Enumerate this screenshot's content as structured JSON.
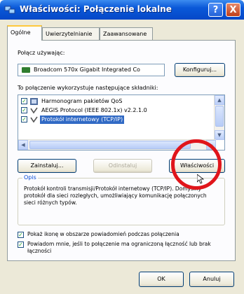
{
  "window": {
    "title": "Właściwości: Połączenie lokalne",
    "help": "?",
    "close": "X"
  },
  "tabs": [
    "Ogólne",
    "Uwierzytelnianie",
    "Zaawansowane"
  ],
  "general": {
    "connect_using_label": "Połącz używając:",
    "device": "Broadcom 570x Gigabit Integrated Co",
    "configure_button": "Konfiguruj...",
    "components_label": "To połączenie wykorzystuje następujące składniki:",
    "components": [
      {
        "label": "Harmonogram pakietów QoS",
        "checked": true,
        "selected": false
      },
      {
        "label": "AEGIS Protocol (IEEE 802.1x) v2.2.1.0",
        "checked": true,
        "selected": false
      },
      {
        "label": "Protokół internetowy (TCP/IP)",
        "checked": true,
        "selected": true
      }
    ],
    "install_button": "Zainstaluj...",
    "uninstall_button": "Odinstaluj",
    "properties_button": "Właściwości",
    "description_legend": "Opis",
    "description": "Protokół kontroli transmisji/Protokół internetowy (TCP/IP). Domyślny protokół dla sieci rozległych, umożliwiający komunikację połączonych sieci różnych typów.",
    "show_icon_checkbox": "Pokaż ikonę w obszarze powiadomień podczas połączenia",
    "notify_checkbox": "Powiadom mnie, jeśli to połączenie ma ograniczoną łączność lub brak łączności"
  },
  "footer": {
    "ok": "OK",
    "cancel": "Anuluj"
  },
  "colors": {
    "titlebar": "#0a58d8",
    "selection": "#316ac5",
    "highlight_circle": "#e0151b"
  }
}
